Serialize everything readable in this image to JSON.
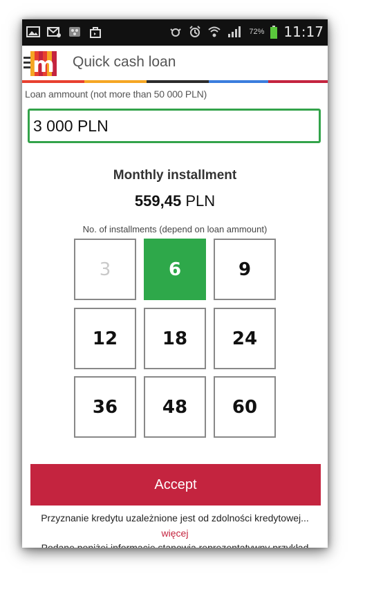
{
  "status_bar": {
    "time": "11:17",
    "battery_percent": "72%",
    "left_icons": [
      "gallery-icon",
      "email-icon",
      "bbm-icon",
      "shopping-bag-icon"
    ],
    "right_icons": [
      "vibrate-icon",
      "alarm-icon",
      "wifi-icon",
      "signal-icon",
      "battery-icon"
    ]
  },
  "app_bar": {
    "title": "Quick cash loan",
    "logo_letter": "m",
    "stripe_colors": [
      "#e8402f",
      "#f5a623",
      "#2c2c2c",
      "#3b7ddd",
      "#c4243f"
    ]
  },
  "loan": {
    "label": "Loan ammount (not more than 50 000 PLN)",
    "value": "3 000 PLN",
    "accent": "#33a34a"
  },
  "installment": {
    "title": "Monthly installment",
    "amount": "559,45",
    "currency": "PLN"
  },
  "installments_label": "No. of installments (depend on loan ammount)",
  "installment_options": [
    {
      "value": "3",
      "state": "disabled"
    },
    {
      "value": "6",
      "state": "selected"
    },
    {
      "value": "9",
      "state": "enabled"
    },
    {
      "value": "12",
      "state": "enabled"
    },
    {
      "value": "18",
      "state": "enabled"
    },
    {
      "value": "24",
      "state": "enabled"
    },
    {
      "value": "36",
      "state": "enabled"
    },
    {
      "value": "48",
      "state": "enabled"
    },
    {
      "value": "60",
      "state": "enabled"
    }
  ],
  "accept_label": "Accept",
  "disclaimer": "Przyznanie kredytu uzależnione jest od zdolności kredytowej...",
  "more_link": "więcej",
  "footer_text": "Podane poniżej informacje stanowią reprezentatywny przykład",
  "colors": {
    "selected": "#2ea84a",
    "accept": "#c4243f",
    "link": "#c4243f"
  }
}
